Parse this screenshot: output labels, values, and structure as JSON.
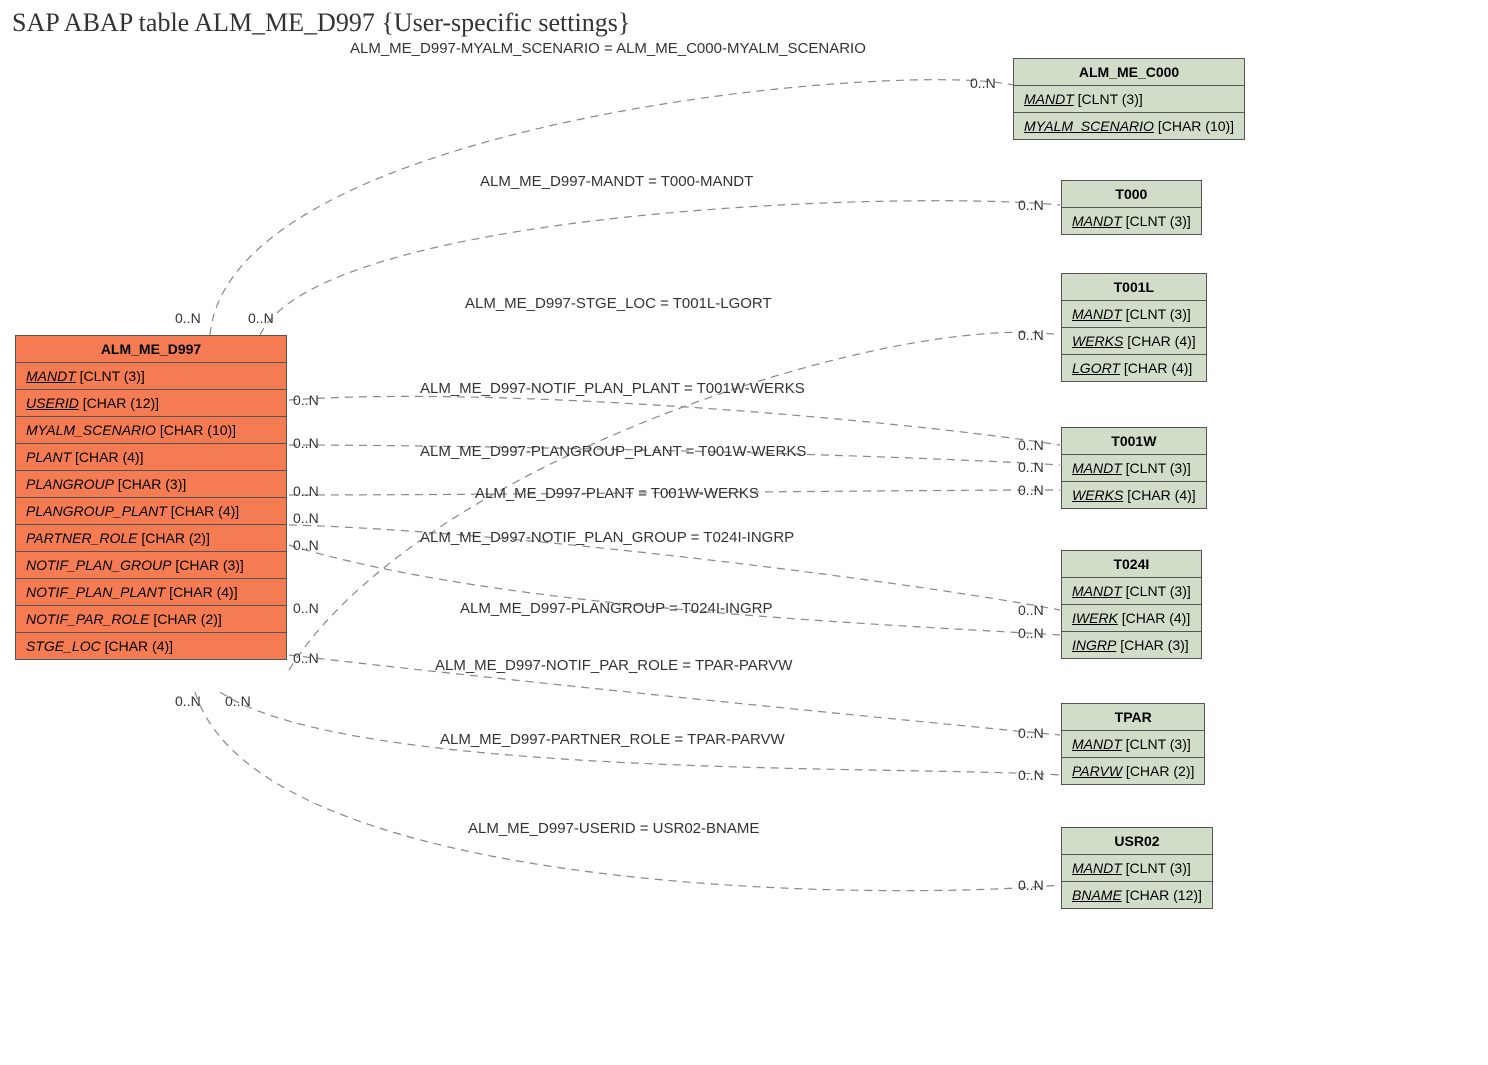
{
  "title": "SAP ABAP table ALM_ME_D997 {User-specific settings}",
  "main": {
    "name": "ALM_ME_D997",
    "fields": [
      {
        "name": "MANDT",
        "type": "[CLNT (3)]",
        "u": true
      },
      {
        "name": "USERID",
        "type": "[CHAR (12)]",
        "u": true
      },
      {
        "name": "MYALM_SCENARIO",
        "type": "[CHAR (10)]",
        "u": false
      },
      {
        "name": "PLANT",
        "type": "[CHAR (4)]",
        "u": false
      },
      {
        "name": "PLANGROUP",
        "type": "[CHAR (3)]",
        "u": false
      },
      {
        "name": "PLANGROUP_PLANT",
        "type": "[CHAR (4)]",
        "u": false
      },
      {
        "name": "PARTNER_ROLE",
        "type": "[CHAR (2)]",
        "u": false
      },
      {
        "name": "NOTIF_PLAN_GROUP",
        "type": "[CHAR (3)]",
        "u": false
      },
      {
        "name": "NOTIF_PLAN_PLANT",
        "type": "[CHAR (4)]",
        "u": false
      },
      {
        "name": "NOTIF_PAR_ROLE",
        "type": "[CHAR (2)]",
        "u": false
      },
      {
        "name": "STGE_LOC",
        "type": "[CHAR (4)]",
        "u": false
      }
    ]
  },
  "refs": [
    {
      "name": "ALM_ME_C000",
      "fields": [
        {
          "name": "MANDT",
          "type": "[CLNT (3)]",
          "u": true
        },
        {
          "name": "MYALM_SCENARIO",
          "type": "[CHAR (10)]",
          "u": true
        }
      ]
    },
    {
      "name": "T000",
      "fields": [
        {
          "name": "MANDT",
          "type": "[CLNT (3)]",
          "u": true
        }
      ]
    },
    {
      "name": "T001L",
      "fields": [
        {
          "name": "MANDT",
          "type": "[CLNT (3)]",
          "u": true
        },
        {
          "name": "WERKS",
          "type": "[CHAR (4)]",
          "u": true
        },
        {
          "name": "LGORT",
          "type": "[CHAR (4)]",
          "u": true
        }
      ]
    },
    {
      "name": "T001W",
      "fields": [
        {
          "name": "MANDT",
          "type": "[CLNT (3)]",
          "u": true
        },
        {
          "name": "WERKS",
          "type": "[CHAR (4)]",
          "u": true
        }
      ]
    },
    {
      "name": "T024I",
      "fields": [
        {
          "name": "MANDT",
          "type": "[CLNT (3)]",
          "u": true
        },
        {
          "name": "IWERK",
          "type": "[CHAR (4)]",
          "u": true
        },
        {
          "name": "INGRP",
          "type": "[CHAR (3)]",
          "u": true
        }
      ]
    },
    {
      "name": "TPAR",
      "fields": [
        {
          "name": "MANDT",
          "type": "[CLNT (3)]",
          "u": true
        },
        {
          "name": "PARVW",
          "type": "[CHAR (2)]",
          "u": true
        }
      ]
    },
    {
      "name": "USR02",
      "fields": [
        {
          "name": "MANDT",
          "type": "[CLNT (3)]",
          "u": true
        },
        {
          "name": "BNAME",
          "type": "[CHAR (12)]",
          "u": true
        }
      ]
    }
  ],
  "relations": [
    {
      "label": "ALM_ME_D997-MYALM_SCENARIO = ALM_ME_C000-MYALM_SCENARIO"
    },
    {
      "label": "ALM_ME_D997-MANDT = T000-MANDT"
    },
    {
      "label": "ALM_ME_D997-STGE_LOC = T001L-LGORT"
    },
    {
      "label": "ALM_ME_D997-NOTIF_PLAN_PLANT = T001W-WERKS"
    },
    {
      "label": "ALM_ME_D997-PLANGROUP_PLANT = T001W-WERKS"
    },
    {
      "label": "ALM_ME_D997-PLANT = T001W-WERKS"
    },
    {
      "label": "ALM_ME_D997-NOTIF_PLAN_GROUP = T024I-INGRP"
    },
    {
      "label": "ALM_ME_D997-PLANGROUP = T024I-INGRP"
    },
    {
      "label": "ALM_ME_D997-NOTIF_PAR_ROLE = TPAR-PARVW"
    },
    {
      "label": "ALM_ME_D997-PARTNER_ROLE = TPAR-PARVW"
    },
    {
      "label": "ALM_ME_D997-USERID = USR02-BNAME"
    }
  ],
  "cardinality": "0..N"
}
